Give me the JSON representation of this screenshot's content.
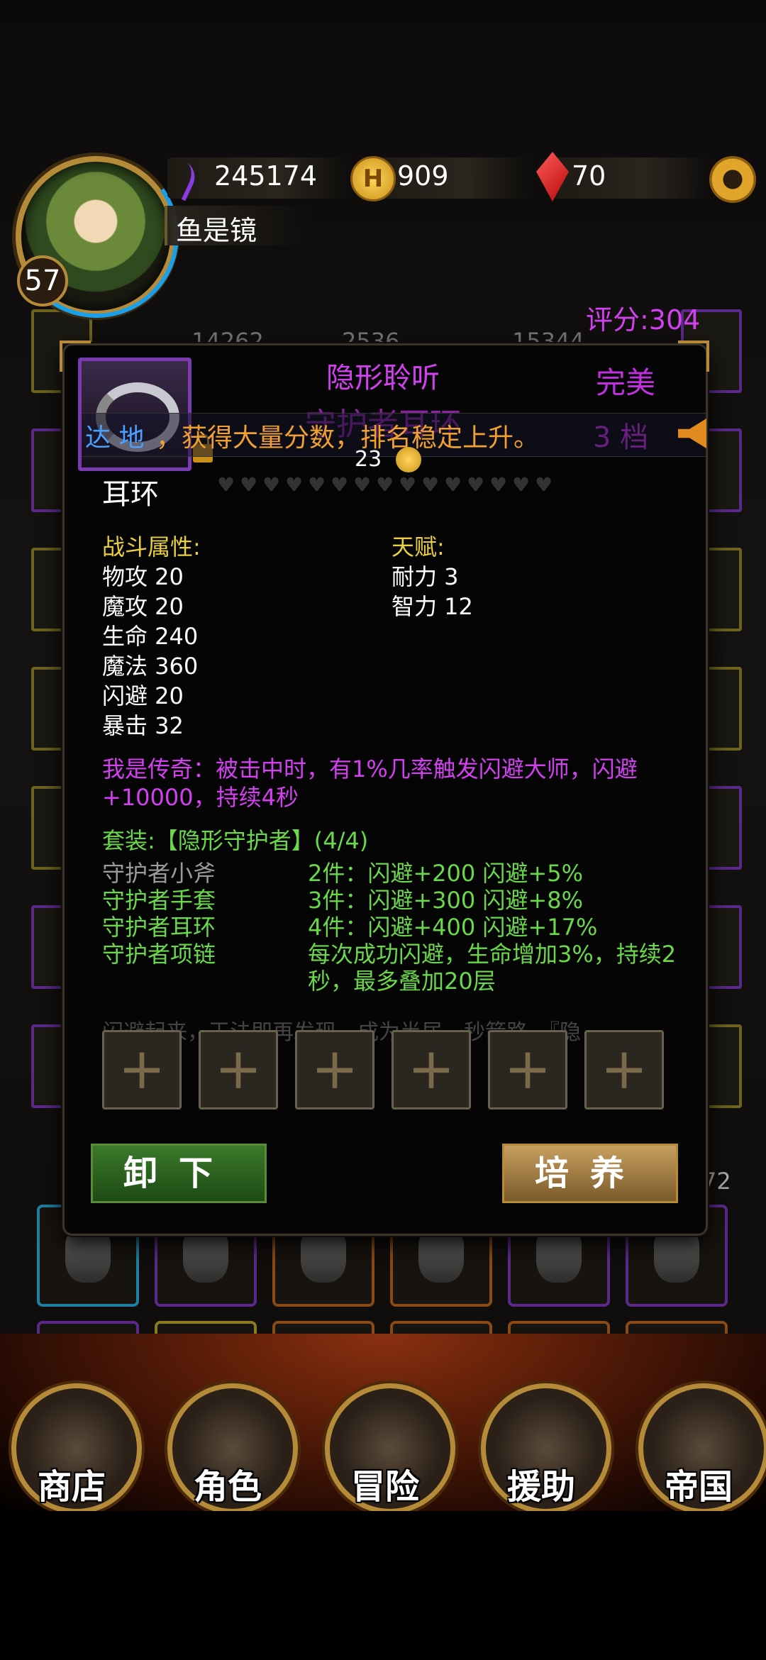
{
  "hud": {
    "power": "245174",
    "gold": "909",
    "gems": "70",
    "player_name": "鱼是镜",
    "level": "57",
    "score": "评分:304",
    "gold_symbol": "H"
  },
  "background_stats": [
    "14262",
    "2536",
    "15344"
  ],
  "background_right_number": "72",
  "item": {
    "name": "隐形聆听",
    "subtitle": "守护者耳环",
    "quality": "完美",
    "grade": "3 档",
    "type": "耳环",
    "upgrade_cost": "23",
    "stars_total": 15
  },
  "ticker": {
    "prefix": "达 地",
    "text": "，获得大量分数，排名稳定上升。"
  },
  "combat": {
    "title": "战斗属性:",
    "stats": [
      "物攻 20",
      "魔攻 20",
      "生命 240",
      "魔法 360",
      "闪避 20",
      "暴击 32"
    ]
  },
  "talent": {
    "title": "天赋:",
    "stats": [
      "耐力 3",
      "智力 12"
    ]
  },
  "legendary": "我是传奇：被击中时，有1%几率触发闪避大师，闪避+10000，持续4秒",
  "set": {
    "title": "套装:【隐形守护者】(4/4)",
    "pieces": [
      {
        "name": "守护者小斧",
        "color": "#9a9a9a"
      },
      {
        "name": "守护者手套",
        "color": "#6ad84a"
      },
      {
        "name": "守护者耳环",
        "color": "#6ad84a"
      },
      {
        "name": "守护者项链",
        "color": "#6ad84a"
      }
    ],
    "bonuses": [
      "2件：闪避+200 闪避+5%",
      "3件：闪避+300 闪避+8%",
      "4件：闪避+400 闪避+17%",
      "每次成功闪避，生命增加3%，持续2秒，最多叠加20层"
    ]
  },
  "faded_line": "闪避起来，王法即再发现，成为半居，秒箭路，『隐",
  "sockets": [
    "+",
    "+",
    "+",
    "+",
    "+",
    "+"
  ],
  "buttons": {
    "unequip": "卸下",
    "cultivate": "培养"
  },
  "nav": [
    "商店",
    "角色",
    "冒险",
    "援助",
    "帝国"
  ],
  "colors": {
    "purple_quality": "#c030e0",
    "set_green": "#6ad84a",
    "title_yellow": "#e8d040",
    "ticker_orange": "#f0a030"
  }
}
